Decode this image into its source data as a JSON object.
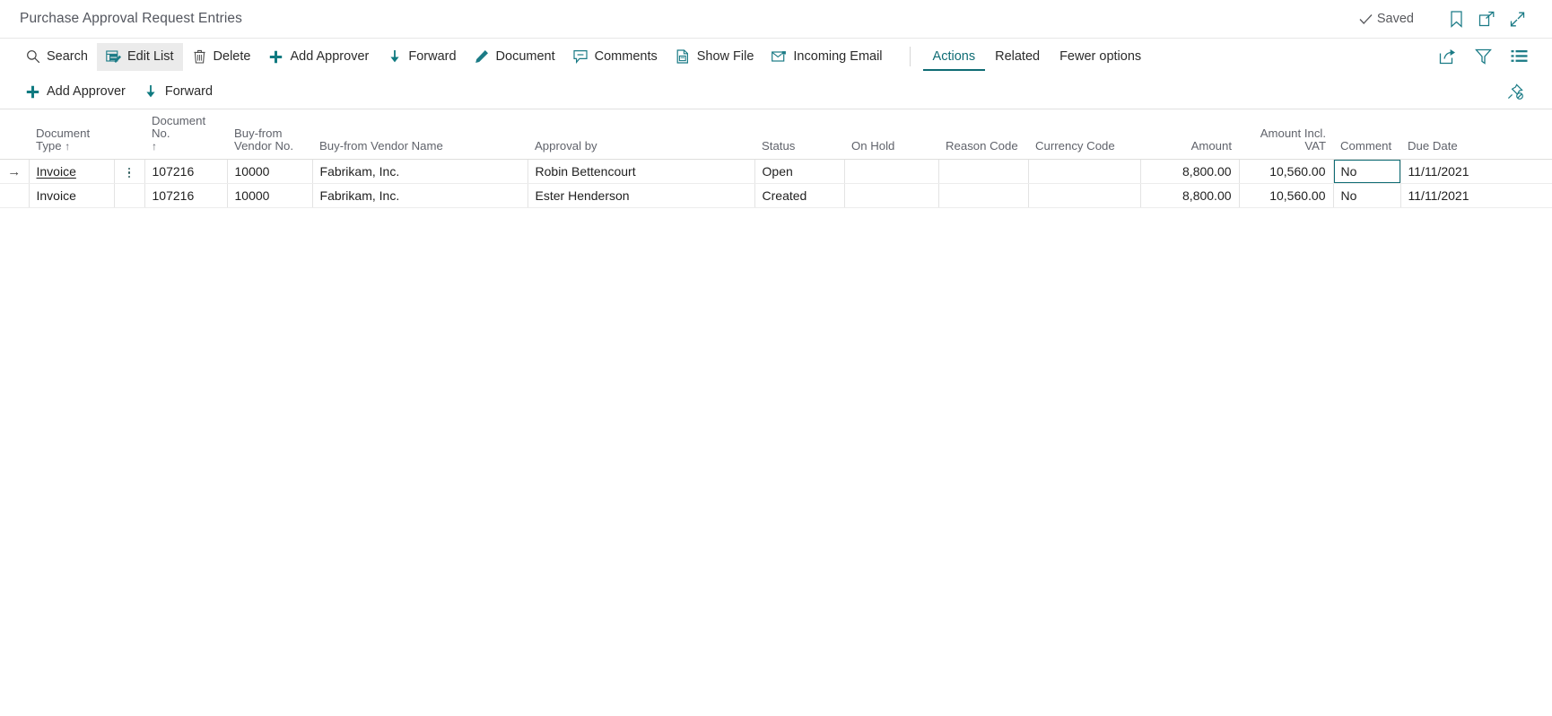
{
  "window": {
    "title": "Purchase Approval Request Entries",
    "saved_label": "Saved",
    "icons": {
      "saved_check": "check-icon",
      "bookmark": "bookmark-icon",
      "open_new_window": "open-in-new-window-icon",
      "collapse": "collapse-icon"
    }
  },
  "ribbon": {
    "buttons": [
      {
        "label": "Search",
        "icon": "search-icon",
        "active": false
      },
      {
        "label": "Edit List",
        "icon": "edit-list-icon",
        "active": true
      },
      {
        "label": "Delete",
        "icon": "trash-icon",
        "active": false
      },
      {
        "label": "Add Approver",
        "icon": "plus-icon",
        "active": false
      },
      {
        "label": "Forward",
        "icon": "arrow-down-icon",
        "active": false
      },
      {
        "label": "Document",
        "icon": "pencil-icon",
        "active": false
      },
      {
        "label": "Comments",
        "icon": "comment-icon",
        "active": false
      },
      {
        "label": "Show File",
        "icon": "show-file-icon",
        "active": false
      },
      {
        "label": "Incoming Email",
        "icon": "email-icon",
        "active": false
      }
    ],
    "menus": [
      {
        "label": "Actions",
        "selected": true
      },
      {
        "label": "Related",
        "selected": false
      },
      {
        "label": "Fewer options",
        "selected": false
      }
    ],
    "right_icons": [
      {
        "name": "share-icon"
      },
      {
        "name": "filter-icon"
      },
      {
        "name": "list-view-icon"
      }
    ]
  },
  "subribbon": {
    "buttons": [
      {
        "label": "Add Approver",
        "icon": "plus-icon"
      },
      {
        "label": "Forward",
        "icon": "arrow-down-icon"
      }
    ],
    "right_icon": "unpin-icon"
  },
  "table": {
    "columns": [
      {
        "key": "document_type",
        "line1": "Document",
        "line2": "Type",
        "sort": "↑",
        "align": "left"
      },
      {
        "key": "document_no",
        "line1": "Document No.",
        "line2": "",
        "sort": "↑",
        "align": "left"
      },
      {
        "key": "buy_from_vendor_no",
        "line1": "Buy-from",
        "line2": "Vendor No.",
        "sort": "",
        "align": "left"
      },
      {
        "key": "buy_from_vendor_name",
        "line1": "",
        "line2": "Buy-from Vendor Name",
        "sort": "",
        "align": "left"
      },
      {
        "key": "approval_by",
        "line1": "",
        "line2": "Approval by",
        "sort": "",
        "align": "left"
      },
      {
        "key": "status",
        "line1": "",
        "line2": "Status",
        "sort": "",
        "align": "left"
      },
      {
        "key": "on_hold",
        "line1": "",
        "line2": "On Hold",
        "sort": "",
        "align": "left"
      },
      {
        "key": "reason_code",
        "line1": "",
        "line2": "Reason Code",
        "sort": "",
        "align": "left"
      },
      {
        "key": "currency_code",
        "line1": "",
        "line2": "Currency Code",
        "sort": "",
        "align": "left"
      },
      {
        "key": "amount",
        "line1": "",
        "line2": "Amount",
        "sort": "",
        "align": "right"
      },
      {
        "key": "amount_incl_vat",
        "line1": "",
        "line2": "Amount Incl. VAT",
        "sort": "",
        "align": "right"
      },
      {
        "key": "comment",
        "line1": "",
        "line2": "Comment",
        "sort": "",
        "align": "left"
      },
      {
        "key": "due_date",
        "line1": "",
        "line2": "Due Date",
        "sort": "",
        "align": "left"
      }
    ],
    "rows": [
      {
        "selected": true,
        "row_indicator": "→",
        "document_type": "Invoice",
        "document_no": "107216",
        "buy_from_vendor_no": "10000",
        "buy_from_vendor_name": "Fabrikam, Inc.",
        "approval_by": "Robin Bettencourt",
        "status": "Open",
        "on_hold": "",
        "reason_code": "",
        "currency_code": "",
        "amount": "8,800.00",
        "amount_incl_vat": "10,560.00",
        "comment": "No",
        "due_date": "11/11/2021"
      },
      {
        "selected": false,
        "row_indicator": "",
        "document_type": "Invoice",
        "document_no": "107216",
        "buy_from_vendor_no": "10000",
        "buy_from_vendor_name": "Fabrikam, Inc.",
        "approval_by": "Ester Henderson",
        "status": "Created",
        "on_hold": "",
        "reason_code": "",
        "currency_code": "",
        "amount": "8,800.00",
        "amount_incl_vat": "10,560.00",
        "comment": "No",
        "due_date": "11/11/2021"
      }
    ]
  },
  "colors": {
    "accent": "#0f6c74",
    "assist_cell": "#b2e5e4",
    "active_button_bg": "#ebebeb",
    "title_text": "#53565e",
    "grid_line": "#e3e3e3"
  }
}
